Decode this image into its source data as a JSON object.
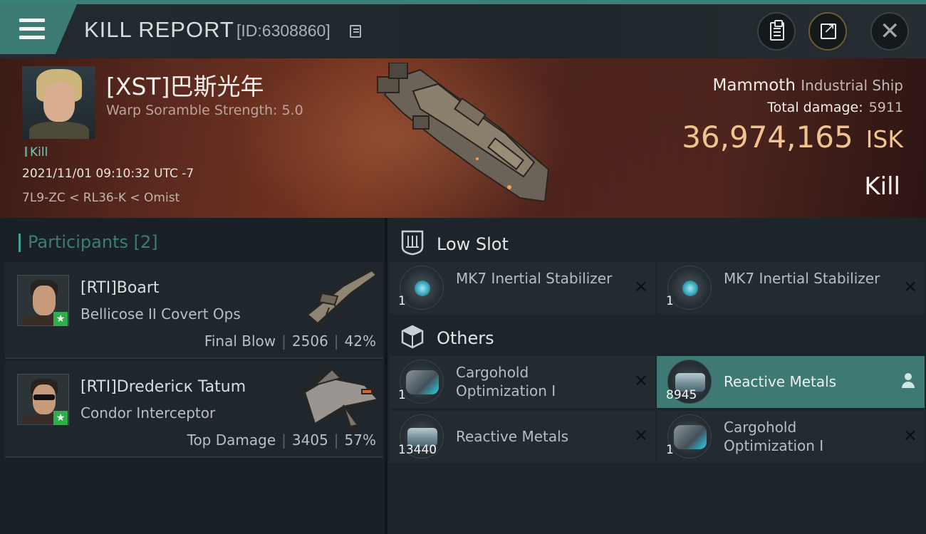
{
  "header": {
    "title": "KILL REPORT",
    "report_id": "[ID:6308860]"
  },
  "victim": {
    "name": "[XST]巴斯光年",
    "scramble": "Warp Soramble Strength: 5.0",
    "kill_tag": "Kill",
    "time": "2021/11/01 09:10:32 UTC -7",
    "location": "7L9-ZC < RL36-K < Omist",
    "ship_name": "Mammoth",
    "ship_class": "Industrial Ship",
    "total_damage_label": "Total damage:",
    "total_damage": "5911",
    "isk_value": "36,974,165",
    "isk_unit": "ISK",
    "result": "Kill"
  },
  "participants": {
    "title": "Participants",
    "count": "[2]",
    "list": [
      {
        "name": "[RTI]Boart",
        "ship": "Bellicose II Covert Ops",
        "role": "Final Blow",
        "damage": "2506",
        "percent": "42%"
      },
      {
        "name": "[RTI]Dredericк Tatum",
        "ship": "Condor Interceptor",
        "role": "Top Damage",
        "damage": "3405",
        "percent": "57%"
      }
    ]
  },
  "sections": {
    "low_slot": "Low Slot",
    "others": "Others"
  },
  "low_slot_items": [
    {
      "qty": "1",
      "name": "MK7 Inertial Stabilizer"
    },
    {
      "qty": "1",
      "name": "MK7 Inertial Stabilizer"
    }
  ],
  "other_items": [
    {
      "qty": "1",
      "name": "Cargohold Optimization I"
    },
    {
      "qty": "8945",
      "name": "Reactive Metals"
    },
    {
      "qty": "13440",
      "name": "Reactive Metals"
    },
    {
      "qty": "1",
      "name": "Cargohold Optimization I"
    }
  ],
  "colors": {
    "accent_teal": "#3c7b73",
    "isk_gold": "#f0c48e",
    "selected_item": "#3e7a73",
    "badge_green": "#2fae4b"
  }
}
